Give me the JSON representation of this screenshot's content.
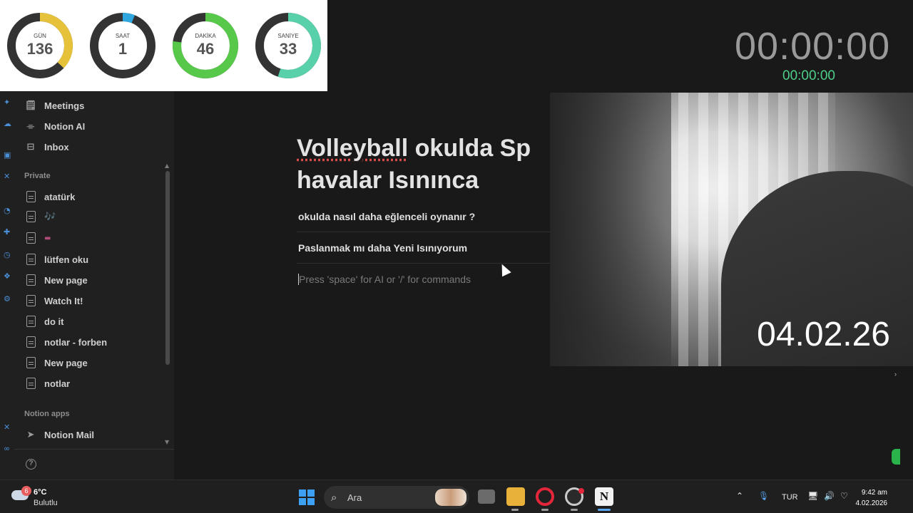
{
  "clocks": {
    "gauges": [
      {
        "label": "GÜN",
        "value": "136",
        "fraction": 0.37,
        "color": "#e6c23b"
      },
      {
        "label": "SAAT",
        "value": "1",
        "fraction": 0.06,
        "color": "#2fa7de"
      },
      {
        "label": "DAKİKA",
        "value": "46",
        "fraction": 0.77,
        "color": "#57c84a"
      },
      {
        "label": "SANİYE",
        "value": "33",
        "fraction": 0.55,
        "color": "#58d1aa"
      }
    ],
    "big_timer": "00:00:00",
    "small_timer": "00:00:00"
  },
  "sidebar": {
    "top_items": [
      {
        "label": "Meetings",
        "icon": "meetings-icon"
      },
      {
        "label": "Notion AI",
        "icon": "notion-ai-icon"
      },
      {
        "label": "Inbox",
        "icon": "inbox-icon"
      }
    ],
    "private_label": "Private",
    "pages": [
      {
        "label": "atatürk"
      },
      {
        "label": "🎶"
      },
      {
        "label": "▬"
      },
      {
        "label": "lütfen oku"
      },
      {
        "label": "New page"
      },
      {
        "label": "Watch It!"
      },
      {
        "label": "do it"
      },
      {
        "label": "notlar - forben"
      },
      {
        "label": "New page"
      },
      {
        "label": "notlar"
      }
    ],
    "apps_label": "Notion apps",
    "apps": [
      {
        "label": "Notion Mail",
        "icon": "send-icon"
      }
    ]
  },
  "editor": {
    "title_spellword": "Volleyball",
    "title_rest_line1": " okulda Sp",
    "title_line2": "havalar Isınınca",
    "lines": [
      "okulda nasıl daha eğlenceli oynanır ?",
      "Paslanmak mı daha Yeni Isınıyorum"
    ],
    "placeholder": "Press 'space' for AI or '/' for commands"
  },
  "webcam": {
    "date": "04.02.26"
  },
  "taskbar": {
    "weather_badge": "6",
    "weather_temp": "6°C",
    "weather_desc": "Bulutlu",
    "search_text": "Ara",
    "language": "TUR",
    "time": "9:42 am",
    "date": "4.02.2026"
  }
}
